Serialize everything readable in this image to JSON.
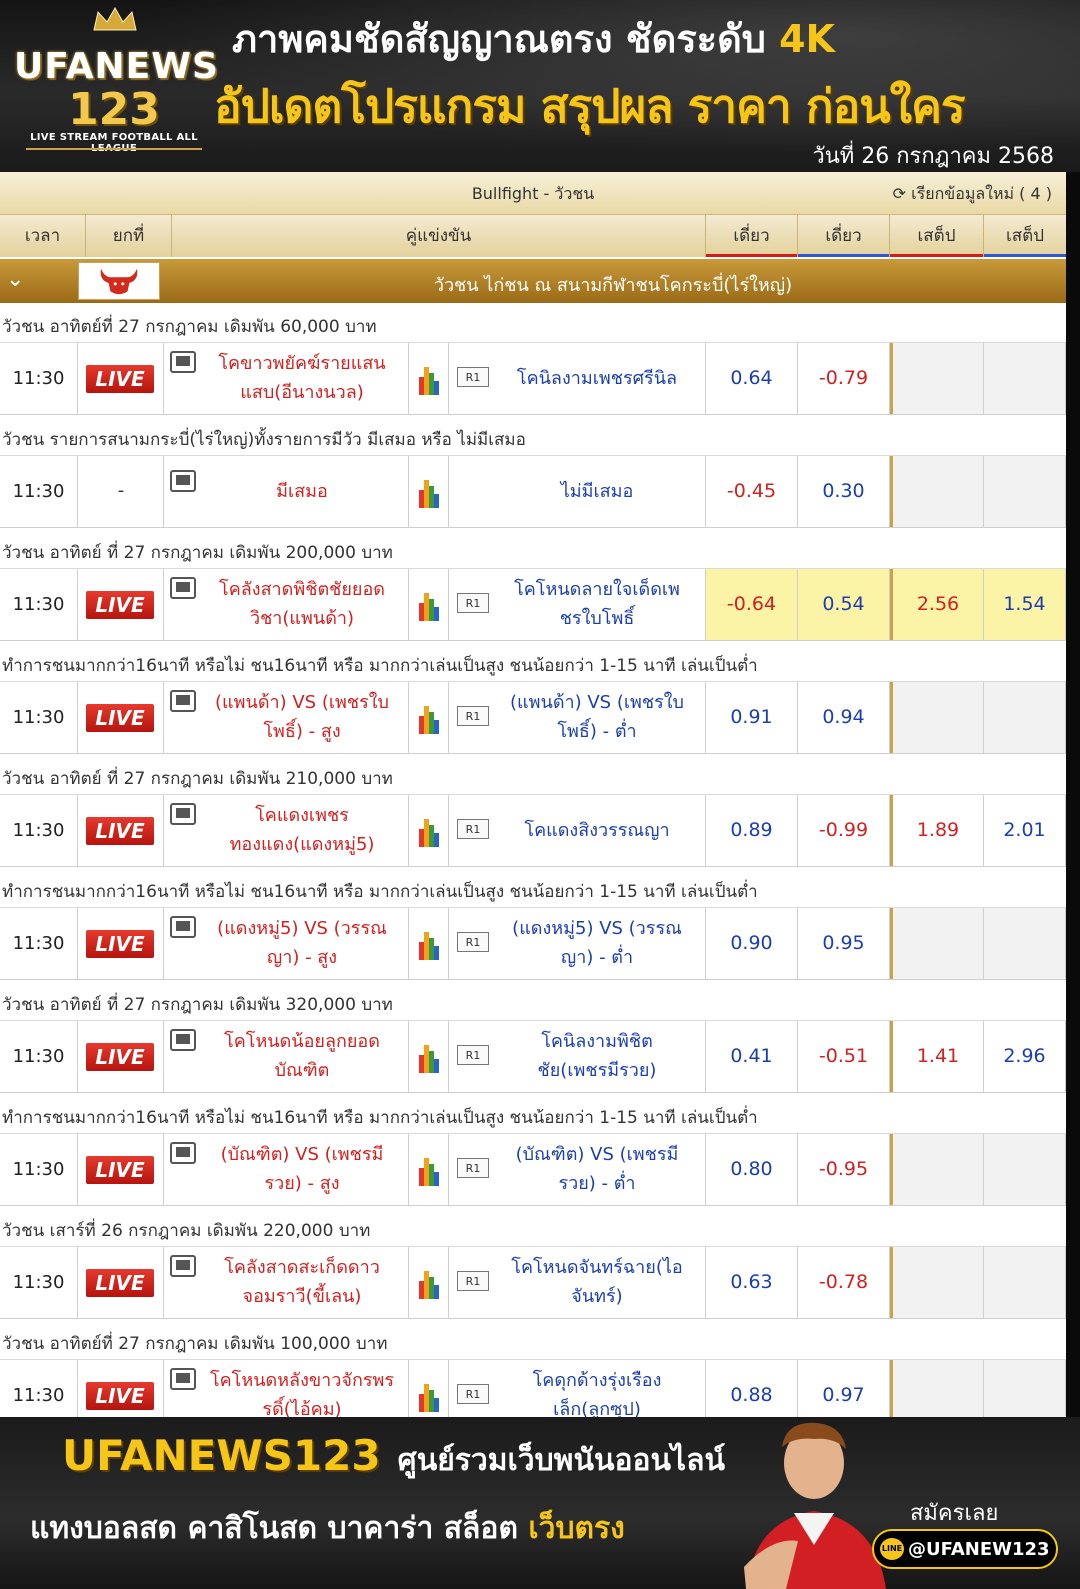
{
  "banner": {
    "logo_brand": "UFANEWS",
    "logo_number": "123",
    "logo_tagline": "LIVE STREAM FOOTBALL ALL LEAGUE",
    "headline": "ภาพคมชัดสัญญาณตรง ชัดระดับ",
    "headline_accent": "4K",
    "subheadline": "อัปเดตโปรแกรม สรุปผล ราคา ก่อนใคร",
    "date": "วันที่ 26 กรกฎาคม 2568"
  },
  "board": {
    "title": "Bullfight - วัวชน",
    "refresh_label": "เรียกข้อมูลใหม่ ( 4 )",
    "columns": {
      "time": "เวลา",
      "round": "ยกที่",
      "match": "คู่แข่งขัน",
      "odds1": "เดี่ยว",
      "odds2": "เดี่ยว",
      "odds3": "เสต็ป",
      "odds4": "เสต็ป"
    },
    "venue": "วัวชน ไก่ชน ณ สนามกีฬาชนโคกระบี่(ไร่ใหญ่)"
  },
  "sections": [
    {
      "label": "วัวชน อาทิตย์ที่ 27 กรกฎาคม เดิมพัน 60,000 บาท",
      "rows": [
        {
          "time": "11:30",
          "status": "LIVE",
          "home": "โคขาวพยัคฆ์รายแสน\nแสบ(อีนางนวล)",
          "away_tag": "R1",
          "away": "โคนิลงามเพชรศรีนิล",
          "o1": "0.64",
          "o2": "-0.79",
          "o3": "",
          "o4": "",
          "highlight": false
        }
      ]
    },
    {
      "label": "วัวชน รายการสนามกระบี่(ไร่ใหญ่)ทั้งรายการมีวัว มีเสมอ หรือ ไม่มีเสมอ",
      "rows": [
        {
          "time": "11:30",
          "status": "-",
          "home": "มีเสมอ",
          "away_tag": "",
          "away": "ไม่มีเสมอ",
          "o1": "-0.45",
          "o2": "0.30",
          "o3": "",
          "o4": "",
          "highlight": false
        }
      ]
    },
    {
      "label": "วัวชน อาทิตย์ ที่ 27 กรกฎาคม เดิมพัน 200,000 บาท",
      "rows": [
        {
          "time": "11:30",
          "status": "LIVE",
          "home": "โคลังสาดพิชิตชัยยอด\nวิชา(แพนด้า)",
          "away_tag": "R1",
          "away": "โคโหนดลายใจเด็ดเพ\nชรใบโพธิ์",
          "o1": "-0.64",
          "o2": "0.54",
          "o3": "2.56",
          "o4": "1.54",
          "highlight": true
        }
      ]
    },
    {
      "label": "ทำการชนมากกว่า16นาที หรือไม่ ชน16นาที หรือ มากกว่าเล่นเป็นสูง ชนน้อยกว่า 1-15 นาที เล่นเป็นต่ำ",
      "rows": [
        {
          "time": "11:30",
          "status": "LIVE",
          "home": "(แพนด้า) VS (เพชรใบ\nโพธิ์) - สูง",
          "away_tag": "R1",
          "away": "(แพนด้า) VS (เพชรใบ\nโพธิ์) - ต่ำ",
          "o1": "0.91",
          "o2": "0.94",
          "o3": "",
          "o4": "",
          "highlight": false
        }
      ]
    },
    {
      "label": "วัวชน อาทิตย์ ที่ 27 กรกฎาคม เดิมพัน 210,000 บาท",
      "rows": [
        {
          "time": "11:30",
          "status": "LIVE",
          "home": "โคแดงเพชร\nทองแดง(แดงหมู่5)",
          "away_tag": "R1",
          "away": "โคแดงสิงวรรณญา",
          "o1": "0.89",
          "o2": "-0.99",
          "o3": "1.89",
          "o4": "2.01",
          "highlight": false
        }
      ]
    },
    {
      "label": "ทำการชนมากกว่า16นาที หรือไม่ ชน16นาที หรือ มากกว่าเล่นเป็นสูง ชนน้อยกว่า 1-15 นาที เล่นเป็นต่ำ",
      "rows": [
        {
          "time": "11:30",
          "status": "LIVE",
          "home": "(แดงหมู่5) VS (วรรณ\nญา) - สูง",
          "away_tag": "R1",
          "away": "(แดงหมู่5) VS (วรรณ\nญา) - ต่ำ",
          "o1": "0.90",
          "o2": "0.95",
          "o3": "",
          "o4": "",
          "highlight": false
        }
      ]
    },
    {
      "label": "วัวชน อาทิตย์ ที่ 27 กรกฎาคม เดิมพัน 320,000 บาท",
      "rows": [
        {
          "time": "11:30",
          "status": "LIVE",
          "home": "โคโหนดน้อยลูกยอด\nบัณฑิต",
          "away_tag": "R1",
          "away": "โคนิลงามพิชิต\nชัย(เพชรมีรวย)",
          "o1": "0.41",
          "o2": "-0.51",
          "o3": "1.41",
          "o4": "2.96",
          "highlight": false
        }
      ]
    },
    {
      "label": "ทำการชนมากกว่า16นาที หรือไม่ ชน16นาที หรือ มากกว่าเล่นเป็นสูง ชนน้อยกว่า 1-15 นาที เล่นเป็นต่ำ",
      "rows": [
        {
          "time": "11:30",
          "status": "LIVE",
          "home": "(บัณฑิต) VS (เพชรมี\nรวย) - สูง",
          "away_tag": "R1",
          "away": "(บัณฑิต) VS (เพชรมี\nรวย) - ต่ำ",
          "o1": "0.80",
          "o2": "-0.95",
          "o3": "",
          "o4": "",
          "highlight": false
        }
      ]
    },
    {
      "label": "วัวชน เสาร์ที่ 26 กรกฎาคม เดิมพัน 220,000 บาท",
      "rows": [
        {
          "time": "11:30",
          "status": "LIVE",
          "home": "โคลังสาดสะเก็ดดาว\nจอมราวี(ขี้เลน)",
          "away_tag": "R1",
          "away": "โคโหนดจันทร์ฉาย(ไอ\nจันทร์)",
          "o1": "0.63",
          "o2": "-0.78",
          "o3": "",
          "o4": "",
          "highlight": false
        }
      ]
    },
    {
      "label": "วัวชน อาทิตย์ที่ 27 กรกฎาคม เดิมพัน 100,000 บาท",
      "rows": [
        {
          "time": "11:30",
          "status": "LIVE",
          "home": "โคโหนดหลังขาวจักรพร\nรดิ์(ไอ้คม)",
          "away_tag": "R1",
          "away": "โคดุกด้างรุ่งเรือง\nเล็ก(ลูกซุป)",
          "o1": "0.88",
          "o2": "0.97",
          "o3": "",
          "o4": "",
          "highlight": false
        }
      ]
    }
  ],
  "footer": {
    "brand": "UFANEWS123",
    "tagline": "ศูนย์รวมเว็บพนันออนไลน์",
    "line2_white": "แทงบอลสด คาสิโนสด บาคาร่า สล็อต",
    "line2_accent": "เว็บตรง",
    "cta": "สมัครเลย",
    "line_badge": "LINE",
    "line_id": "@UFANEW123"
  },
  "colors": {
    "accent_gold": "#f5c518",
    "header_band": "#c99a3a",
    "live_red": "#d42020",
    "odds_blue": "#1c3fb0",
    "highlight_yellow": "#fbf3a6"
  }
}
